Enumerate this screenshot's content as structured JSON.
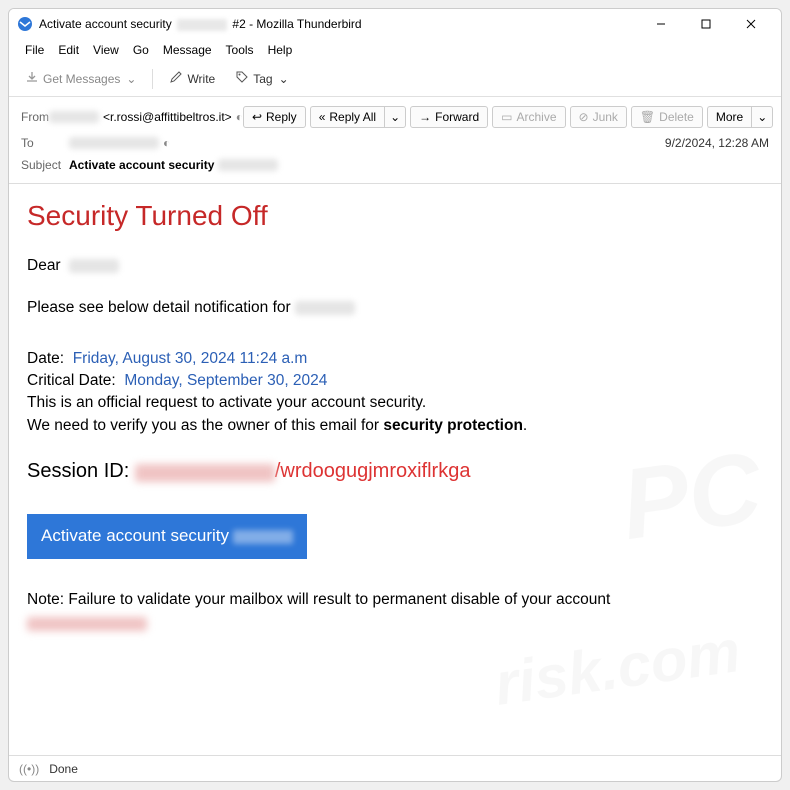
{
  "window": {
    "title_prefix": "Activate account security",
    "title_suffix": "#2 - Mozilla Thunderbird"
  },
  "menubar": [
    "File",
    "Edit",
    "View",
    "Go",
    "Message",
    "Tools",
    "Help"
  ],
  "toolbar": {
    "get_messages": "Get Messages",
    "write": "Write",
    "tag": "Tag"
  },
  "actions": {
    "reply": "Reply",
    "reply_all": "Reply All",
    "forward": "Forward",
    "archive": "Archive",
    "junk": "Junk",
    "delete": "Delete",
    "more": "More"
  },
  "header": {
    "from_label": "From",
    "from_email": "<r.rossi@affittibeltros.it>",
    "to_label": "To",
    "subject_label": "Subject",
    "subject_value": "Activate account security",
    "timestamp": "9/2/2024, 12:28 AM"
  },
  "body": {
    "h1": "Security Turned Off",
    "dear": "Dear",
    "please_see": "Please see below detail notification for",
    "date_label": "Date:",
    "date_value": "Friday, August  30, 2024 11:24 a.m",
    "critical_label": "Critical Date:",
    "critical_value": "Monday, September  30, 2024",
    "line1": "This is an official request to activate your account security.",
    "line2a": "We need to verify you as the owner of this email for ",
    "line2b": "security protection",
    "session_label": "Session ID:",
    "session_tail": "/wrdoogugjmroxiflrkga",
    "activate_btn": "Activate account security",
    "note_label": "Note:",
    "note_text": " Failure to validate your mailbox will result to permanent disable of your account"
  },
  "statusbar": {
    "done": "Done"
  }
}
